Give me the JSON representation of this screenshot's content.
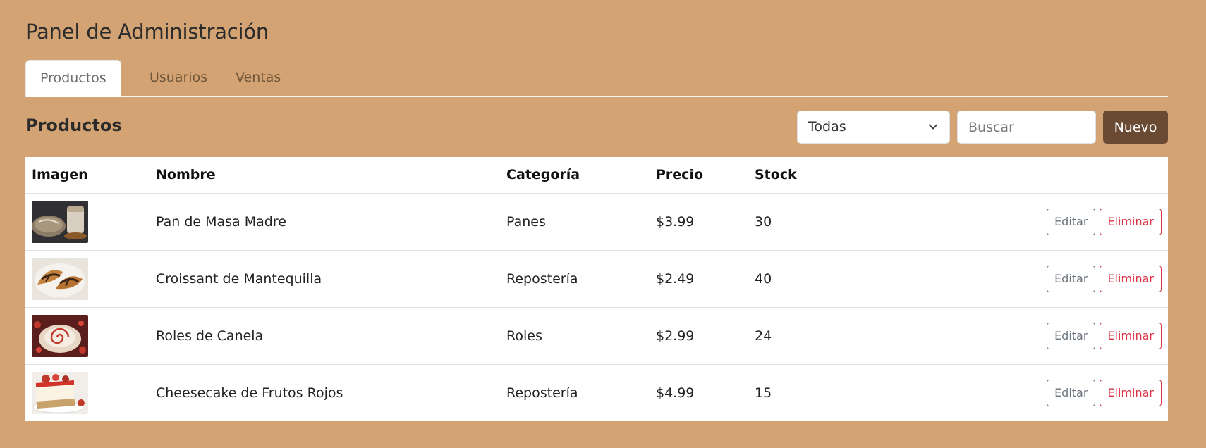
{
  "header": {
    "title": "Panel de Administración"
  },
  "tabs": [
    {
      "label": "Productos",
      "active": true
    },
    {
      "label": "Usuarios",
      "active": false
    },
    {
      "label": "Ventas",
      "active": false
    }
  ],
  "section": {
    "title": "Productos"
  },
  "toolbar": {
    "category_selected": "Todas",
    "search_placeholder": "Buscar",
    "new_label": "Nuevo"
  },
  "table": {
    "headers": [
      "Imagen",
      "Nombre",
      "Categoría",
      "Precio",
      "Stock"
    ],
    "rows": [
      {
        "name": "Pan de Masa Madre",
        "category": "Panes",
        "price": "$3.99",
        "stock": "30",
        "image": "sourdough-bread-image"
      },
      {
        "name": "Croissant de Mantequilla",
        "category": "Repostería",
        "price": "$2.49",
        "stock": "40",
        "image": "croissant-image"
      },
      {
        "name": "Roles de Canela",
        "category": "Roles",
        "price": "$2.99",
        "stock": "24",
        "image": "cinnamon-roll-image"
      },
      {
        "name": "Cheesecake de Frutos Rojos",
        "category": "Repostería",
        "price": "$4.99",
        "stock": "15",
        "image": "cheesecake-image"
      }
    ],
    "edit_label": "Editar",
    "delete_label": "Eliminar"
  },
  "colors": {
    "background": "#d4a373",
    "primary_button": "#6b4a33",
    "danger": "#dc3545",
    "secondary": "#6c757d"
  }
}
